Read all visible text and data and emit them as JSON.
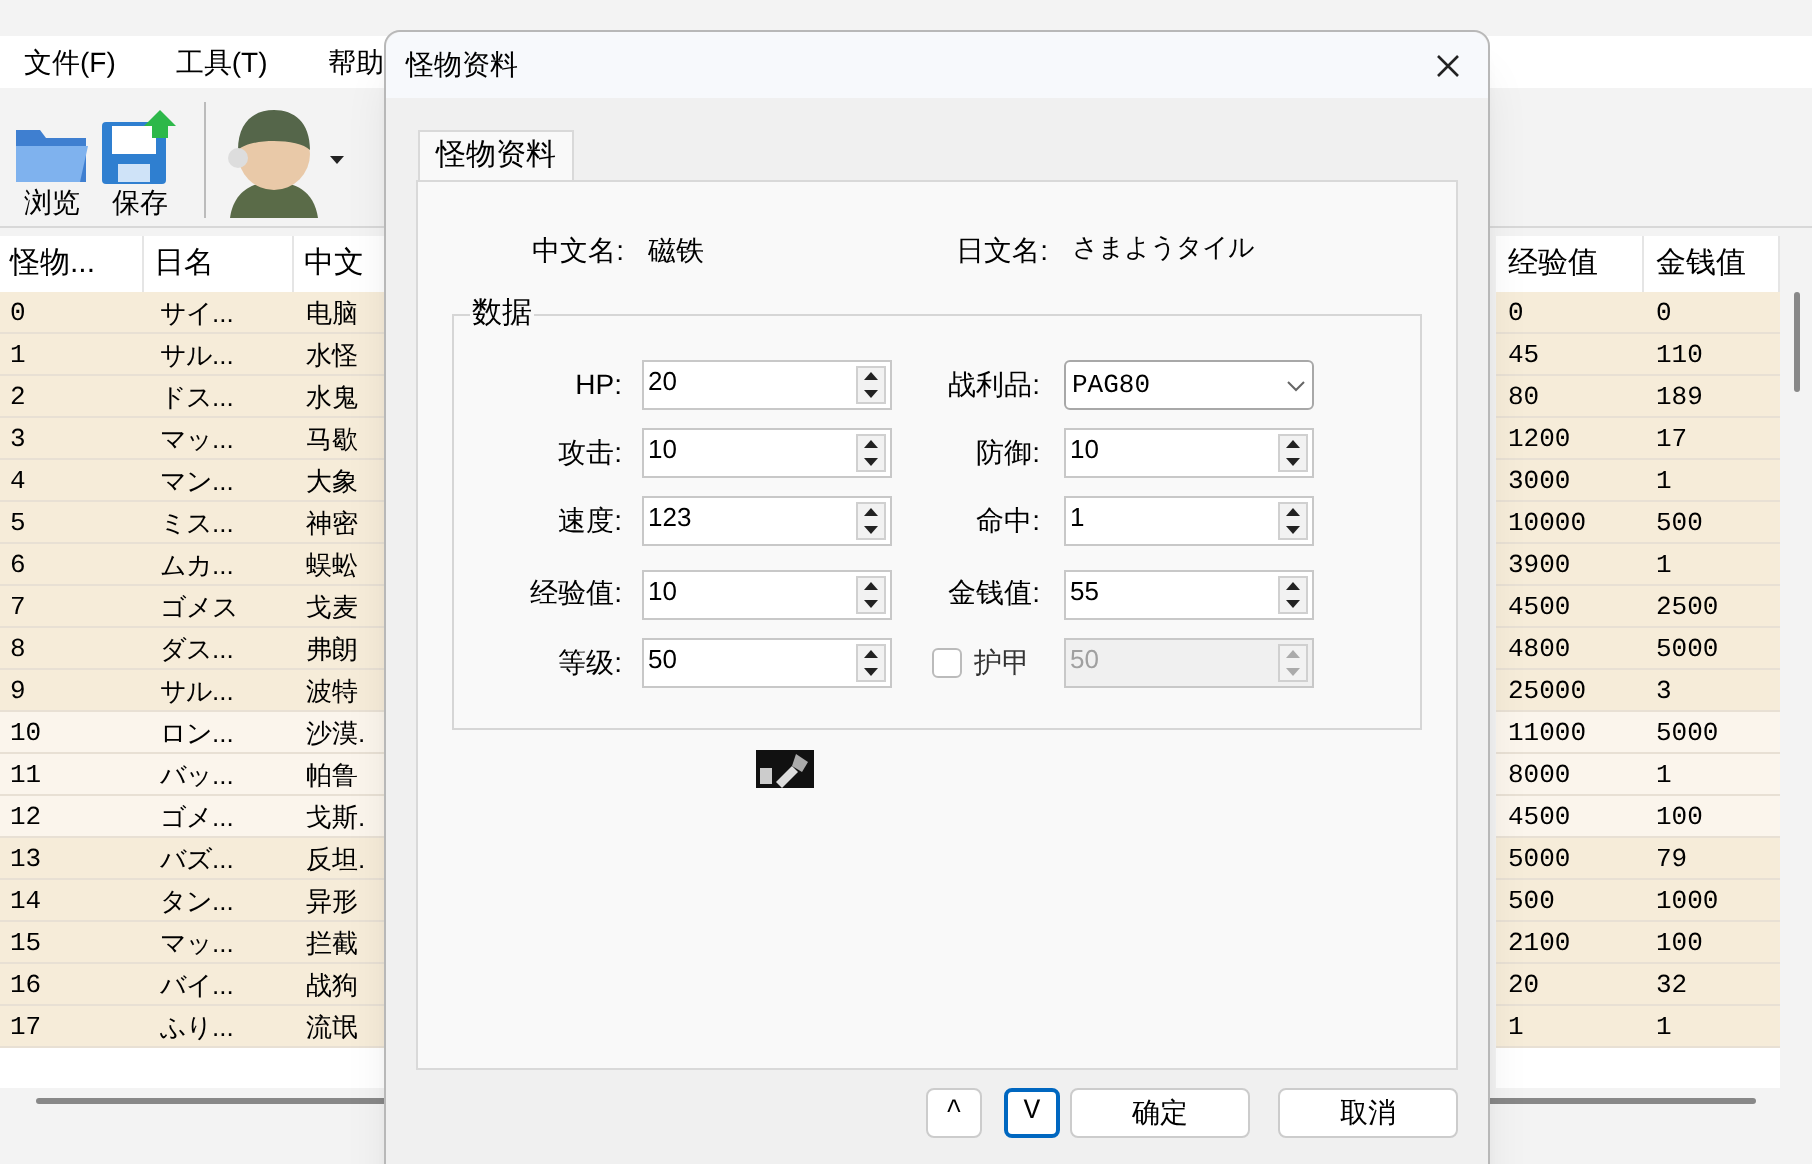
{
  "menu": [
    "文件(F)",
    "工具(T)",
    "帮助"
  ],
  "toolbar": [
    {
      "kind": "folder",
      "label": "浏览"
    },
    {
      "kind": "save",
      "label": "保存"
    },
    {
      "kind": "avatar"
    }
  ],
  "table": {
    "columns_left": [
      "怪物...",
      "日名",
      "中文"
    ],
    "columns_right": [
      "经验值",
      "金钱值"
    ],
    "rows": [
      {
        "id": "0",
        "jp_name": "サイ...",
        "cn_name": "电脑",
        "exp": "0",
        "gold": "0"
      },
      {
        "id": "1",
        "jp_name": "サル...",
        "cn_name": "水怪",
        "exp": "45",
        "gold": "110"
      },
      {
        "id": "2",
        "jp_name": "ドス...",
        "cn_name": "水鬼",
        "exp": "80",
        "gold": "189"
      },
      {
        "id": "3",
        "jp_name": "マッ...",
        "cn_name": "马歇",
        "exp": "1200",
        "gold": "17"
      },
      {
        "id": "4",
        "jp_name": "マン...",
        "cn_name": "大象",
        "exp": "3000",
        "gold": "1"
      },
      {
        "id": "5",
        "jp_name": "ミス...",
        "cn_name": "神密",
        "exp": "10000",
        "gold": "500"
      },
      {
        "id": "6",
        "jp_name": "ムカ...",
        "cn_name": "蜈蚣",
        "exp": "3900",
        "gold": "1"
      },
      {
        "id": "7",
        "jp_name": "ゴメス",
        "cn_name": "戈麦",
        "exp": "4500",
        "gold": "2500"
      },
      {
        "id": "8",
        "jp_name": "ダス...",
        "cn_name": "弗朗",
        "exp": "4800",
        "gold": "5000"
      },
      {
        "id": "9",
        "jp_name": "サル...",
        "cn_name": "波特",
        "exp": "25000",
        "gold": "3"
      },
      {
        "id": "10",
        "jp_name": "ロン...",
        "cn_name": "沙漠.",
        "exp": "11000",
        "gold": "5000"
      },
      {
        "id": "11",
        "jp_name": "バッ...",
        "cn_name": "帕鲁",
        "exp": "8000",
        "gold": "1"
      },
      {
        "id": "12",
        "jp_name": "ゴメ...",
        "cn_name": "戈斯.",
        "exp": "4500",
        "gold": "100"
      },
      {
        "id": "13",
        "jp_name": "バズ...",
        "cn_name": "反坦.",
        "exp": "5000",
        "gold": "79"
      },
      {
        "id": "14",
        "jp_name": "タン...",
        "cn_name": "异形",
        "exp": "500",
        "gold": "1000"
      },
      {
        "id": "15",
        "jp_name": "マッ...",
        "cn_name": "拦截",
        "exp": "2100",
        "gold": "100"
      },
      {
        "id": "16",
        "jp_name": "バイ...",
        "cn_name": "战狗",
        "exp": "20",
        "gold": "32"
      },
      {
        "id": "17",
        "jp_name": "ふり...",
        "cn_name": "流氓",
        "exp": "1",
        "gold": "1"
      }
    ]
  },
  "dialog": {
    "title": "怪物资料",
    "tabs": [
      {
        "label": "怪物资料",
        "selected": true
      }
    ],
    "cn_name": {
      "label": "中文名:",
      "value": "磁铁"
    },
    "jp_name": {
      "label": "日文名:",
      "value": "さまようタイル"
    },
    "group": "数据",
    "fields": [
      {
        "kind": "spin",
        "label": "HP:",
        "value": "20"
      },
      {
        "kind": "select",
        "label": "战利品:",
        "value": "PAG80"
      },
      {
        "kind": "spin",
        "label": "攻击:",
        "value": "10"
      },
      {
        "kind": "spin",
        "label": "防御:",
        "value": "10"
      },
      {
        "kind": "spin",
        "label": "速度:",
        "value": "123"
      },
      {
        "kind": "spin",
        "label": "命中:",
        "value": "1"
      },
      {
        "kind": "spin",
        "label": "经验值:",
        "value": "10"
      },
      {
        "kind": "spin",
        "label": "金钱值:",
        "value": "55"
      },
      {
        "kind": "spin",
        "label": "等级:",
        "value": "50"
      },
      {
        "kind": "check_spin",
        "label": "护甲",
        "checked": false,
        "value": "50"
      }
    ],
    "buttons": [
      {
        "label": "^",
        "focused": false
      },
      {
        "label": "V",
        "focused": true
      },
      {
        "label": "确定",
        "focused": false
      },
      {
        "label": "取消",
        "focused": false
      }
    ]
  }
}
